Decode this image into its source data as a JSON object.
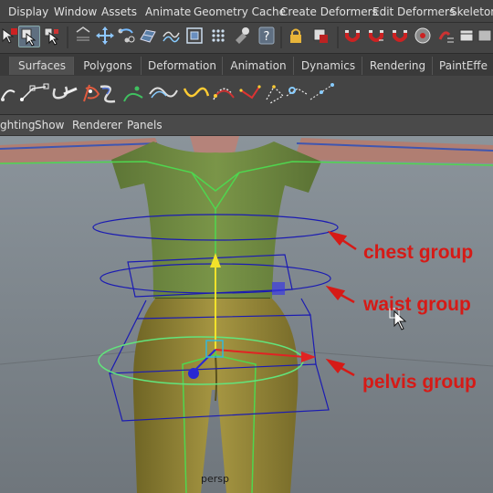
{
  "menubar": {
    "items": [
      "Display",
      "Window",
      "Assets",
      "Animate",
      "Geometry Cache",
      "Create Deformers",
      "Edit Deformers",
      "Skeleton"
    ]
  },
  "shelf_tabs": {
    "items": [
      "Surfaces",
      "Polygons",
      "Deformation",
      "Animation",
      "Dynamics",
      "Rendering",
      "PaintEffe"
    ],
    "active": "Surfaces"
  },
  "panel_menu": {
    "items": [
      "ghting",
      "Show",
      "Renderer",
      "Panels"
    ]
  },
  "viewport": {
    "camera_label": "persp",
    "annotations": [
      "chest group",
      "waist group",
      "pelvis group"
    ]
  },
  "colors": {
    "ui_bg": "#444444",
    "viewport_bg": "#818a91",
    "shirt": "#6f8a44",
    "pants": "#9b8c3c",
    "annotation": "#d61a16",
    "wire": "#1b1bb2"
  },
  "icons": {
    "status_line": [
      "select-by-hierarchy-icon",
      "select-by-object-icon",
      "select-by-component-icon",
      "snap-to-grid-icon",
      "snap-to-curve-icon",
      "snap-to-point-icon",
      "snap-to-surface-icon",
      "make-live-icon",
      "history-icon",
      "help-icon",
      "lock-icon",
      "select-tool-icon",
      "magnet-icon",
      "magnet-icon",
      "magnet-icon",
      "render-icon",
      "script-icon",
      "window-icon"
    ],
    "shelf": [
      "cv-curve-icon",
      "ep-curve-icon",
      "pencil-curve-icon",
      "arc-icon",
      "curve-tool-icon",
      "circle-curve-icon",
      "attach-curve-icon",
      "detach-curve-icon",
      "bezier-curve-icon",
      "rebuild-curve-icon",
      "fillet-curve-icon",
      "offset-curve-icon",
      "extend-curve-icon"
    ]
  }
}
